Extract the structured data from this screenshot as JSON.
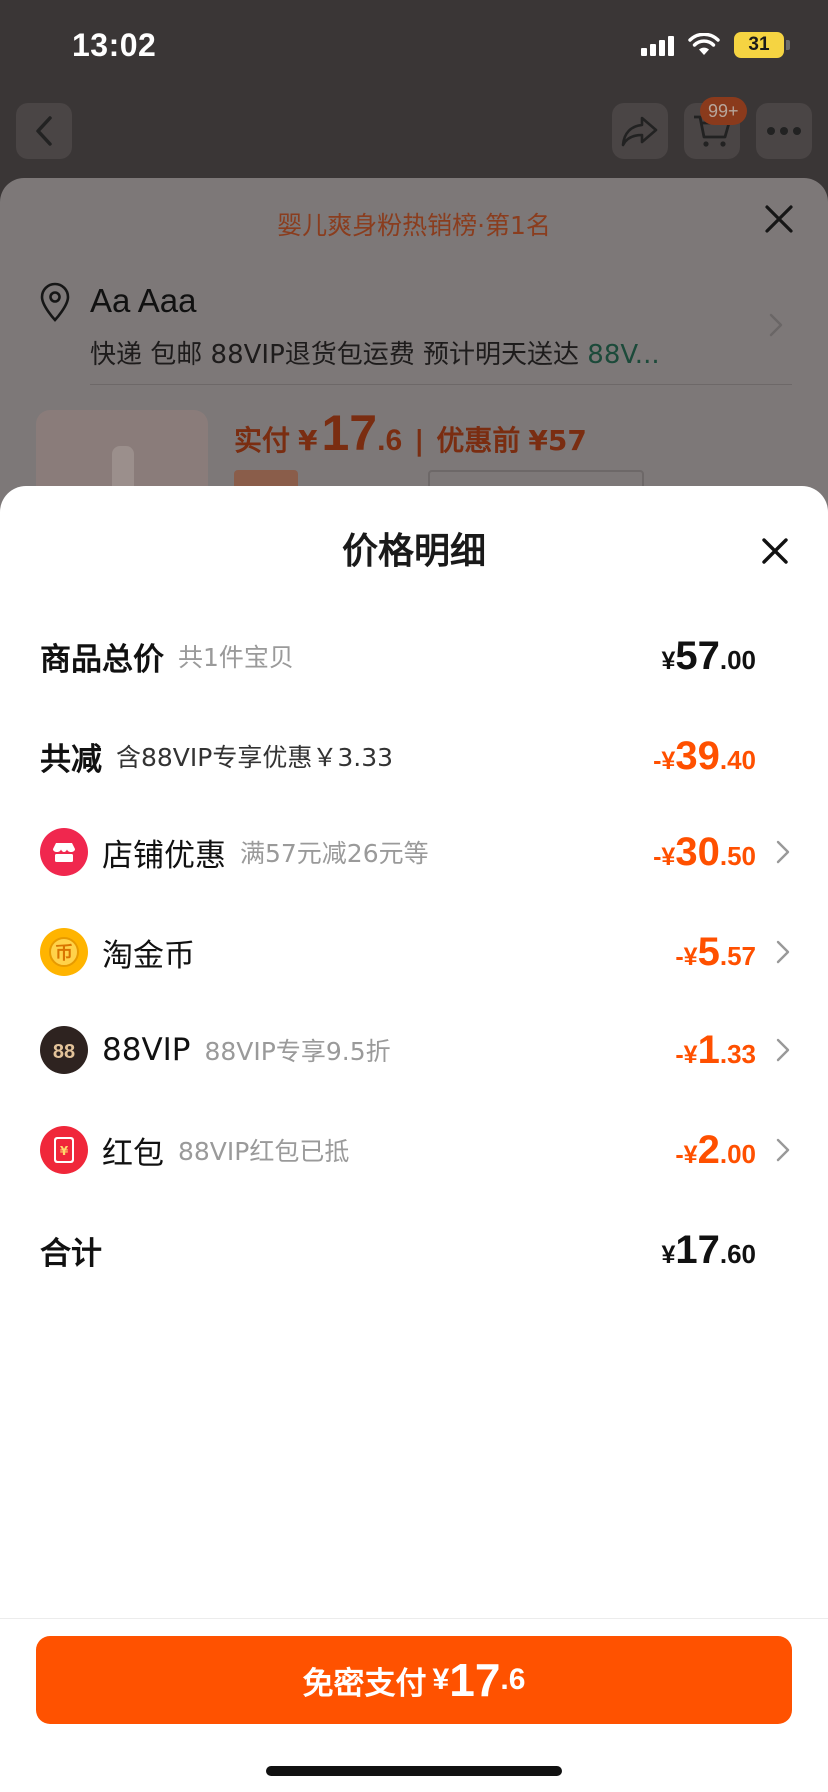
{
  "status_bar": {
    "time": "13:02",
    "battery": "31"
  },
  "background": {
    "cart_badge": "99+",
    "rank_banner": "婴儿爽身粉热销榜·第1名",
    "address_name": "Aa Aaa",
    "shipping_text": "快递 包邮 88VIP退货包运费 预计明天送达 ",
    "shipping_vip": "88V...",
    "price": {
      "label": "实付",
      "currency": "¥",
      "int": "17",
      "dec": ".6",
      "separator": "|",
      "before_label": "优惠前",
      "before_value": "¥57"
    }
  },
  "sheet": {
    "title": "价格明细",
    "rows": [
      {
        "label": "商品总价",
        "note": "共1件宝贝",
        "amount_cur": "¥",
        "amount_int": "57",
        "amount_dec": ".00"
      },
      {
        "label": "共减",
        "note": "含88VIP专享优惠￥3.33",
        "amount_cur": "-¥",
        "amount_int": "39",
        "amount_dec": ".40"
      },
      {
        "label": "店铺优惠",
        "note": "满57元减26元等",
        "amount_cur": "-¥",
        "amount_int": "30",
        "amount_dec": ".50"
      },
      {
        "label": "淘金币",
        "note": "",
        "amount_cur": "-¥",
        "amount_int": "5",
        "amount_dec": ".57"
      },
      {
        "label": "88VIP",
        "note": "88VIP专享9.5折",
        "amount_cur": "-¥",
        "amount_int": "1",
        "amount_dec": ".33"
      },
      {
        "label": "红包",
        "note": "88VIP红包已抵",
        "amount_cur": "-¥",
        "amount_int": "2",
        "amount_dec": ".00"
      },
      {
        "label": "合计",
        "note": "",
        "amount_cur": "¥",
        "amount_int": "17",
        "amount_dec": ".60"
      }
    ],
    "pay_button": {
      "label": "免密支付",
      "currency": "¥",
      "int": "17",
      "dec": ".6"
    }
  },
  "colors": {
    "accent": "#ff5000",
    "pay_button": "#ff5200"
  },
  "icons": {
    "shop": "shop-icon",
    "coin": "taojinbi-coin-icon",
    "vip": "88vip-icon",
    "redpacket": "red-packet-icon"
  }
}
